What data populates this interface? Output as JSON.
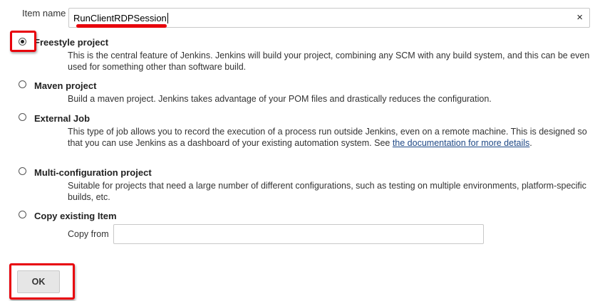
{
  "form": {
    "item_name_label": "Item name",
    "item_name_value": "RunClientRDPSession",
    "clear_glyph": "×",
    "copy_from_label": "Copy from",
    "copy_from_value": "",
    "ok_label": "OK"
  },
  "job_types": [
    {
      "label": "Freestyle project",
      "selected": true,
      "description": "This is the central feature of Jenkins. Jenkins will build your project, combining any SCM with any build system, and this can be even used for something other than software build."
    },
    {
      "label": "Maven project",
      "selected": false,
      "description": "Build a maven project. Jenkins takes advantage of your POM files and drastically reduces the configuration."
    },
    {
      "label": "External Job",
      "selected": false,
      "description_before_link": "This type of job allows you to record the execution of a process run outside Jenkins, even on a remote machine. This is designed so that you can use Jenkins as a dashboard of your existing automation system. See ",
      "link_text": "the documentation for more details",
      "description_after_link": "."
    },
    {
      "label": "Multi-configuration project",
      "selected": false,
      "description": "Suitable for projects that need a large number of different configurations, such as testing on multiple environments, platform-specific builds, etc."
    },
    {
      "label": "Copy existing Item",
      "selected": false
    }
  ],
  "colors": {
    "annotation_red": "#e8000b",
    "link": "#204a87"
  },
  "icons": {
    "clear": "close-icon",
    "radio": "radio-button"
  }
}
